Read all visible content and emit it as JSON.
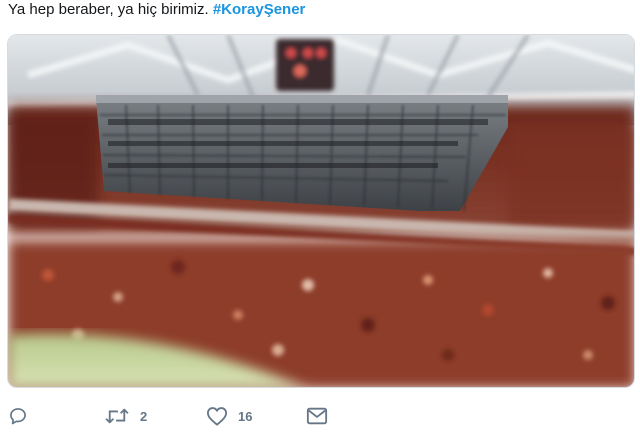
{
  "tweet": {
    "text": "Ya hep beraber, ya hiç birimiz. ",
    "hashtag": "#KorayŞener"
  },
  "media": {
    "description_icon": "stadium-photo",
    "accent_color": "#1b95e0"
  },
  "actions": {
    "reply_icon": "reply-icon",
    "retweet_icon": "retweet-icon",
    "retweet_count": "2",
    "like_icon": "heart-icon",
    "like_count": "16",
    "message_icon": "envelope-icon"
  }
}
